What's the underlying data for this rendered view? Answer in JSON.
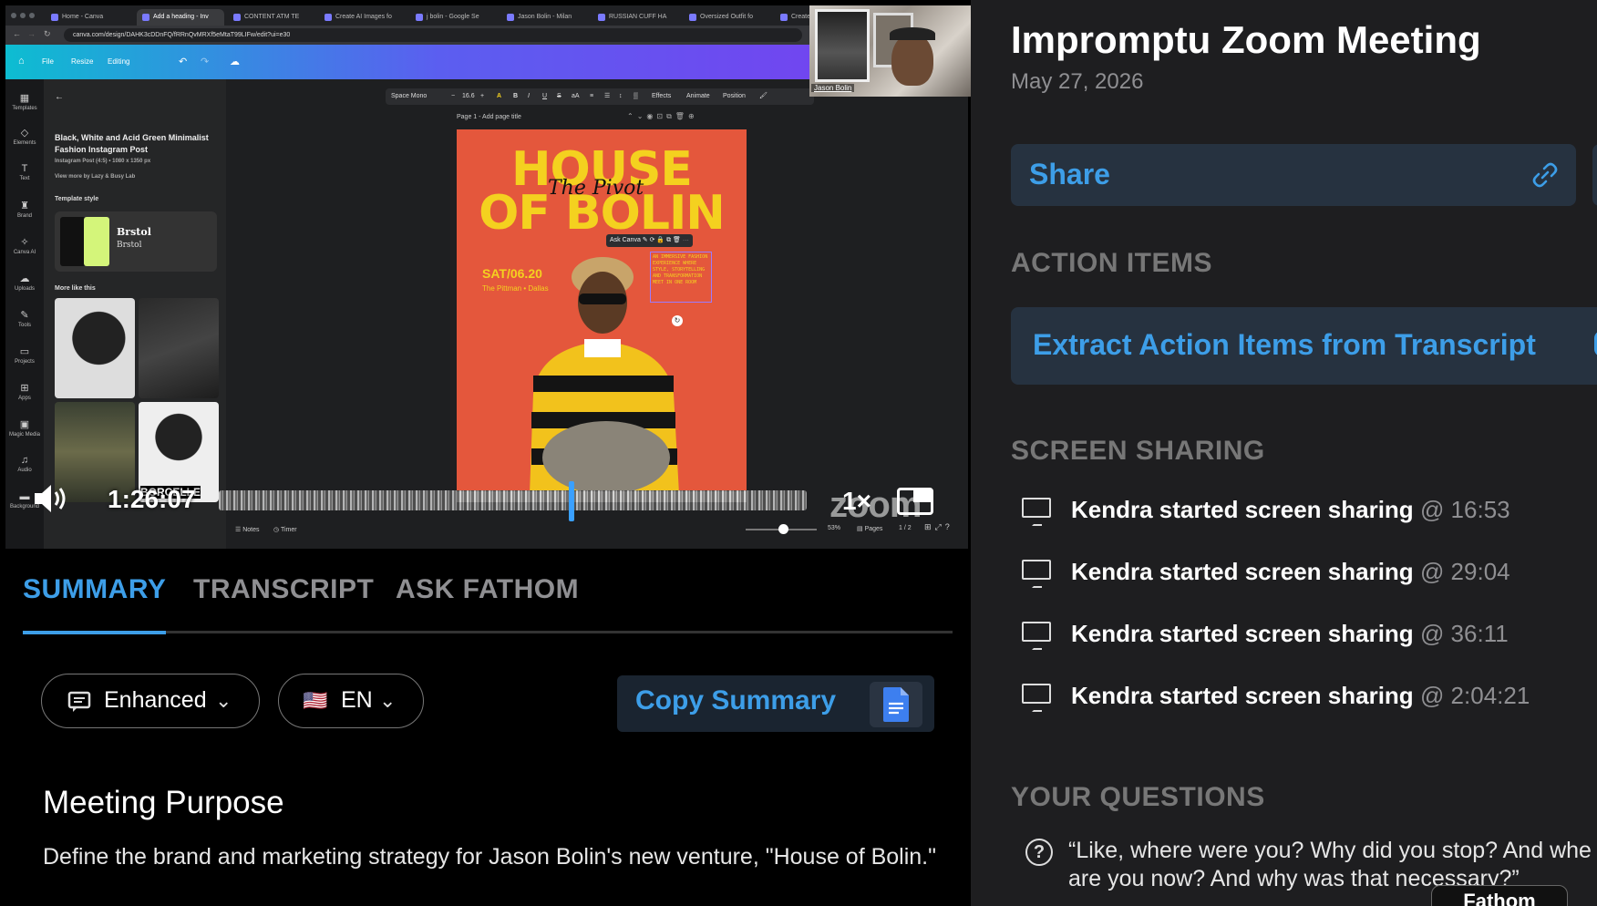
{
  "browser": {
    "tabs": [
      "Home - Canva",
      "Add a heading - Inv",
      "CONTENT ATM TE",
      "Create AI Images fo",
      "j bolin - Google Se",
      "Jason Bolin - Milan",
      "RUSSIAN CUFF HA",
      "Oversized Outfit fo",
      "Create"
    ],
    "url": "canva.com/design/DAHK3cDDnFQ/fRRnQvMRXf5eMtaT99LIFw/edit?ui=e30"
  },
  "canva": {
    "menu": [
      "File",
      "Resize",
      "Editing"
    ],
    "rail": [
      "Templates",
      "Elements",
      "Text",
      "Brand",
      "Canva AI",
      "Uploads",
      "Tools",
      "Projects",
      "Apps",
      "Magic Media",
      "Audio",
      "Background"
    ],
    "template_title": "Black, White and Acid Green Minimalist Fashion Instagram Post",
    "template_size": "Instagram Post (4:5) • 1080 x 1350 px",
    "template_author": "View more by Lazy & Busy Lab",
    "template_style_label": "Template style",
    "style_sample": "Brstol",
    "more_like_label": "More like this",
    "font_name": "Space Mono",
    "font_size": "16.6",
    "toolbar_items": [
      "Effects",
      "Animate",
      "Position"
    ],
    "page_label": "Page 1 - Add page title",
    "ask_canva": "Ask Canva",
    "poster_title_line1": "HOUSE",
    "poster_title_line2": "OF BOLIN",
    "poster_script": "The Pivot",
    "poster_date": "SAT/06.20",
    "poster_venue": "The Pittman • Dallas",
    "poster_body": "AN IMMERSIVE FASHION EXPERIENCE WHERE STYLE, STORYTELLING AND TRANSFORMATION MEET IN ONE ROOM",
    "thumb_text": "BORCELLE",
    "notes_label": "Notes",
    "timer_label": "Timer",
    "zoom_percent": "53%",
    "pages_label": "Pages",
    "pages_count": "1 / 2"
  },
  "webcam": {
    "name_tag": "Jason Bolin"
  },
  "player": {
    "time": "1:26:07",
    "speed": "1×",
    "watermark": "zoom",
    "progress": 0.6
  },
  "tabs": [
    "SUMMARY",
    "TRANSCRIPT",
    "ASK FATHOM"
  ],
  "summary": {
    "mode": "Enhanced",
    "language_flag": "🇺🇸",
    "language": "EN",
    "copy_label": "Copy Summary",
    "purpose_title": "Meeting Purpose",
    "purpose_text": "Define the brand and marketing strategy for Jason Bolin's new venture, \"House of Bolin.\""
  },
  "meeting": {
    "title": "Impromptu Zoom Meeting",
    "date": "May 27, 2026",
    "share_label": "Share",
    "action_items_header": "ACTION ITEMS",
    "extract_label": "Extract Action Items from Transcript",
    "screen_sharing_header": "SCREEN SHARING",
    "screen_sharing": [
      {
        "text": "Kendra started screen sharing",
        "time": "@ 16:53"
      },
      {
        "text": "Kendra started screen sharing",
        "time": "@ 29:04"
      },
      {
        "text": "Kendra started screen sharing",
        "time": "@ 36:11"
      },
      {
        "text": "Kendra started screen sharing",
        "time": "@ 2:04:21"
      }
    ],
    "questions_header": "YOUR QUESTIONS",
    "question_line1": "“Like, where were you? Why did you stop? And whe",
    "question_line2": "are you now? And why was that necessary?”",
    "fathom_tab": "Fathom"
  },
  "colors": {
    "accent": "#3d9ee8",
    "poster_bg": "#e4573c",
    "poster_yellow": "#f4d11f"
  }
}
